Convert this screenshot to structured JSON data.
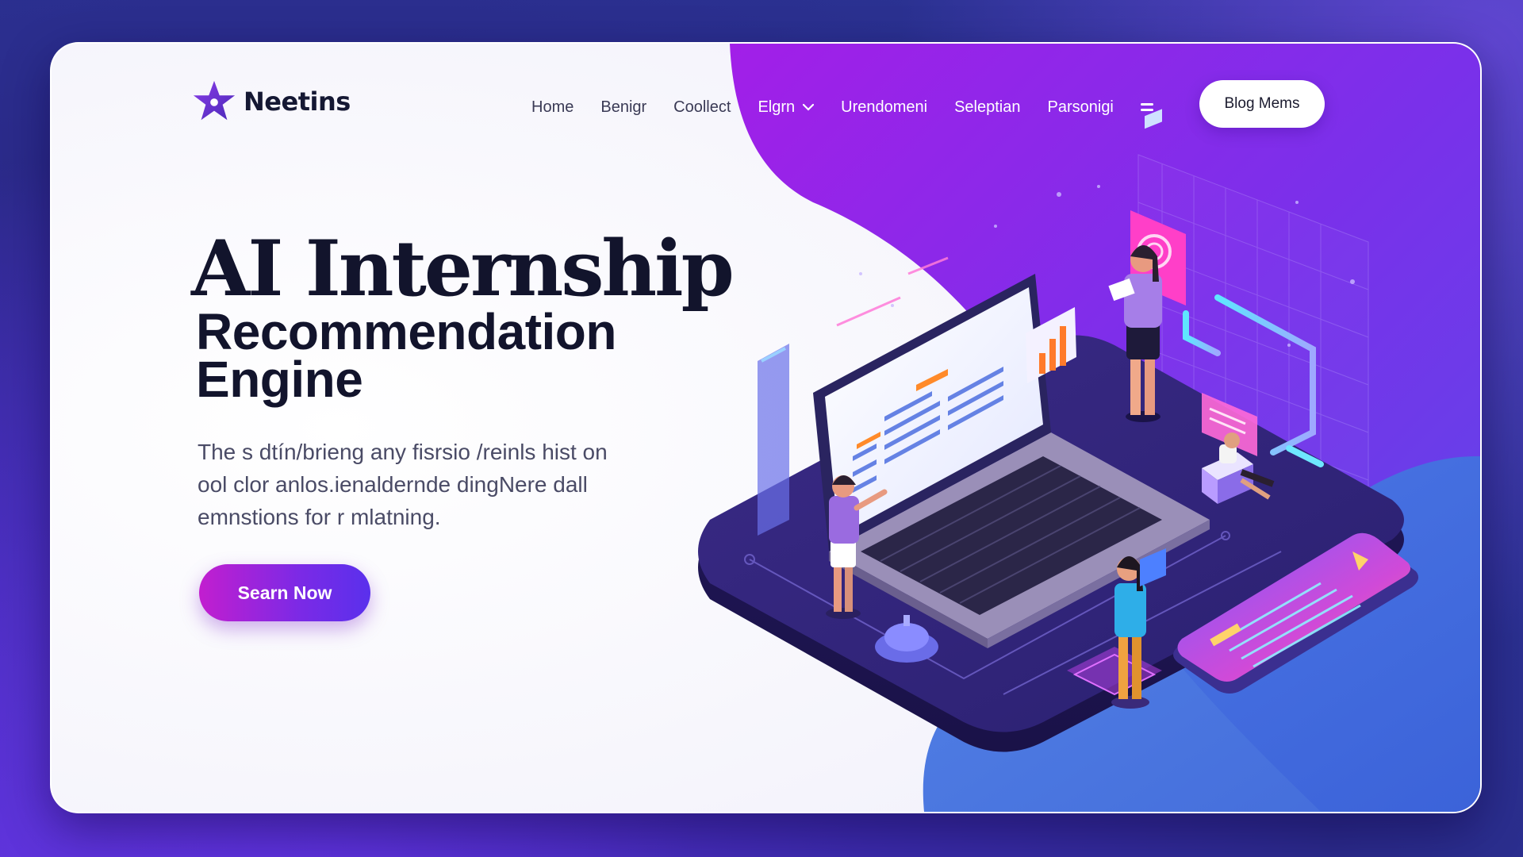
{
  "brand": {
    "name": "Neetins",
    "icon": "star-logo-icon",
    "color": "#6a2fd8"
  },
  "nav": {
    "items": [
      {
        "label": "Home"
      },
      {
        "label": "Benigr"
      },
      {
        "label": "Coollect"
      },
      {
        "label": "Elgrn",
        "icon": "chevron-down-icon"
      },
      {
        "label": "Urendomeni"
      },
      {
        "label": "Seleptian"
      },
      {
        "label": "Parsonigi"
      }
    ],
    "menu_icon": "menu-icon",
    "cta_label": "Blog Mems"
  },
  "hero": {
    "title": "AI Internship",
    "subtitle_line1": "Recommendation",
    "subtitle_line2": "Engine",
    "description": "The s dtín/brieng any fisrsio /reinls hist on ool clor anlos.ienaldernde dingNere dall emnstions for r mlatning.",
    "cta_label": "Searn Now"
  },
  "colors": {
    "accent_purple": "#8a2be2",
    "accent_magenta": "#c21ecf",
    "accent_blue": "#3d7be0",
    "dark_text": "#12142c",
    "panel_light": "#ffffff"
  }
}
